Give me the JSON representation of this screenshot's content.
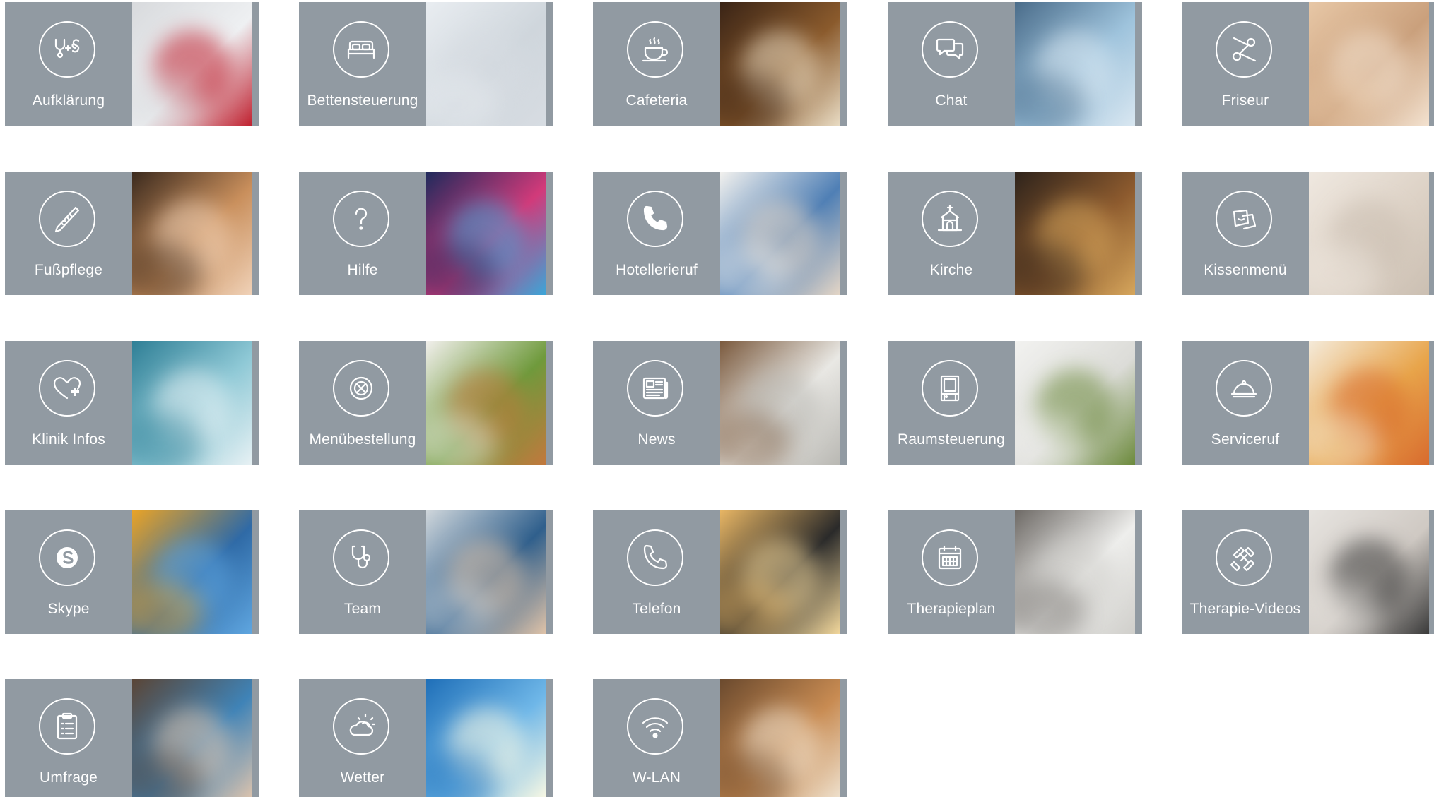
{
  "tiles": [
    {
      "label": "Aufklärung",
      "icon": "stethoscope-paragraph-icon",
      "photo": "stethoscope and paragraph sign",
      "colors": [
        "#d8dadd",
        "#eef0f2",
        "#c0202f"
      ]
    },
    {
      "label": "Bettensteuerung",
      "icon": "bed-icon",
      "photo": "patient in bed with tablet",
      "colors": [
        "#e9edf1",
        "#cfd6dc",
        "#d7dce2"
      ]
    },
    {
      "label": "Cafeteria",
      "icon": "coffee-cup-icon",
      "photo": "espresso machine",
      "colors": [
        "#3a2416",
        "#8a5a2c",
        "#e9dcc4"
      ]
    },
    {
      "label": "Chat",
      "icon": "chat-bubbles-icon",
      "photo": "live chat on tablet",
      "colors": [
        "#4a6c8a",
        "#9ec3dc",
        "#d9e7f1"
      ]
    },
    {
      "label": "Friseur",
      "icon": "scissors-icon",
      "photo": "hair cutting",
      "colors": [
        "#e7c7a6",
        "#caa07c",
        "#f3e2d0"
      ]
    },
    {
      "label": "Fußpflege",
      "icon": "nail-file-icon",
      "photo": "feet in bowl",
      "colors": [
        "#3b2a1e",
        "#c98f5c",
        "#f0d2b8"
      ]
    },
    {
      "label": "Hilfe",
      "icon": "question-mark-icon",
      "photo": "colorful media screens",
      "colors": [
        "#1f2a5c",
        "#d23a7a",
        "#3aa6d8"
      ]
    },
    {
      "label": "Hotellerieruf",
      "icon": "phone-handset-icon",
      "photo": "nurse on phone",
      "colors": [
        "#f2f1ee",
        "#4f7fb5",
        "#e5d6c6"
      ]
    },
    {
      "label": "Kirche",
      "icon": "church-icon",
      "photo": "wooden cross",
      "colors": [
        "#2e231b",
        "#8c5a2e",
        "#d6a65c"
      ]
    },
    {
      "label": "Kissenmenü",
      "icon": "pillows-icon",
      "photo": "pillows on bed",
      "colors": [
        "#efe8e0",
        "#ddd2c6",
        "#cbbfb2"
      ]
    },
    {
      "label": "Klinik Infos",
      "icon": "heart-plus-icon",
      "photo": "doctor with digital interface",
      "colors": [
        "#2f7f96",
        "#8fc9d6",
        "#e7f1f4"
      ]
    },
    {
      "label": "Menübestellung",
      "icon": "plate-cutlery-icon",
      "photo": "salad bowl",
      "colors": [
        "#f1efec",
        "#6f9a3c",
        "#c2783d"
      ]
    },
    {
      "label": "News",
      "icon": "newspaper-icon",
      "photo": "newspaper and phone",
      "colors": [
        "#7b5a3e",
        "#e9e8e4",
        "#b9b8b3"
      ]
    },
    {
      "label": "Raumsteuerung",
      "icon": "window-icon",
      "photo": "window with blinds",
      "colors": [
        "#f2f2f0",
        "#dcdcd8",
        "#6c8a3c"
      ]
    },
    {
      "label": "Serviceruf",
      "icon": "cloche-icon",
      "photo": "breakfast in bed",
      "colors": [
        "#f4ead9",
        "#e8a54b",
        "#d86b2e"
      ]
    },
    {
      "label": "Skype",
      "icon": "skype-icon",
      "photo": "earphones and phone",
      "colors": [
        "#e9a326",
        "#2f6aa6",
        "#5fa6e0"
      ]
    },
    {
      "label": "Team",
      "icon": "stethoscope-icon",
      "photo": "medical team",
      "colors": [
        "#cfd6db",
        "#2f5f8c",
        "#e0c3a8"
      ]
    },
    {
      "label": "Telefon",
      "icon": "telephone-icon",
      "photo": "desk telephone",
      "colors": [
        "#e7b564",
        "#2a2a2a",
        "#f3d89c"
      ]
    },
    {
      "label": "Therapieplan",
      "icon": "calendar-icon",
      "photo": "calendar",
      "colors": [
        "#6e6a66",
        "#eeeeec",
        "#d0cfcb"
      ]
    },
    {
      "label": "Therapie-Videos",
      "icon": "dumbbells-icon",
      "photo": "senior exercising",
      "colors": [
        "#e6e3df",
        "#cfc9c3",
        "#3a3a3a"
      ]
    },
    {
      "label": "Umfrage",
      "icon": "clipboard-icon",
      "photo": "two women talking",
      "colors": [
        "#5a4536",
        "#3f83b7",
        "#e3c6ad"
      ]
    },
    {
      "label": "Wetter",
      "icon": "sun-cloud-icon",
      "photo": "sun in blue sky",
      "colors": [
        "#1f6fb8",
        "#6fb7e8",
        "#fffbe3"
      ]
    },
    {
      "label": "W-LAN",
      "icon": "wifi-icon",
      "photo": "hands holding tablet",
      "colors": [
        "#6b4a2e",
        "#c88b52",
        "#f0e4d2"
      ]
    }
  ]
}
